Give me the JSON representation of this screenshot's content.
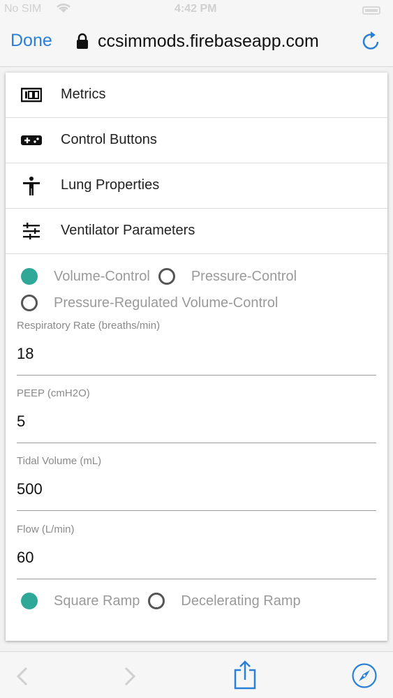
{
  "status_bar": {
    "carrier": "No SIM",
    "time": "4:42 PM"
  },
  "nav": {
    "done_label": "Done",
    "url": "ccsimmods.firebaseapp.com"
  },
  "menu": {
    "items": [
      {
        "label": "Metrics",
        "icon": "metrics-100-icon"
      },
      {
        "label": "Control Buttons",
        "icon": "gamepad-icon"
      },
      {
        "label": "Lung Properties",
        "icon": "person-icon"
      },
      {
        "label": "Ventilator Parameters",
        "icon": "sliders-icon"
      }
    ]
  },
  "mode": {
    "options": [
      "Volume-Control",
      "Pressure-Control",
      "Pressure-Regulated Volume-Control"
    ],
    "selected": "Volume-Control"
  },
  "fields": [
    {
      "label": "Respiratory Rate (breaths/min)",
      "value": "18"
    },
    {
      "label": "PEEP (cmH2O)",
      "value": "5"
    },
    {
      "label": "Tidal Volume (mL)",
      "value": "500"
    },
    {
      "label": "Flow (L/min)",
      "value": "60"
    }
  ],
  "ramp": {
    "options": [
      "Square Ramp",
      "Decelerating Ramp"
    ],
    "selected": "Square Ramp"
  },
  "colors": {
    "accent": "#2fa89a",
    "link": "#2a7fd6"
  }
}
